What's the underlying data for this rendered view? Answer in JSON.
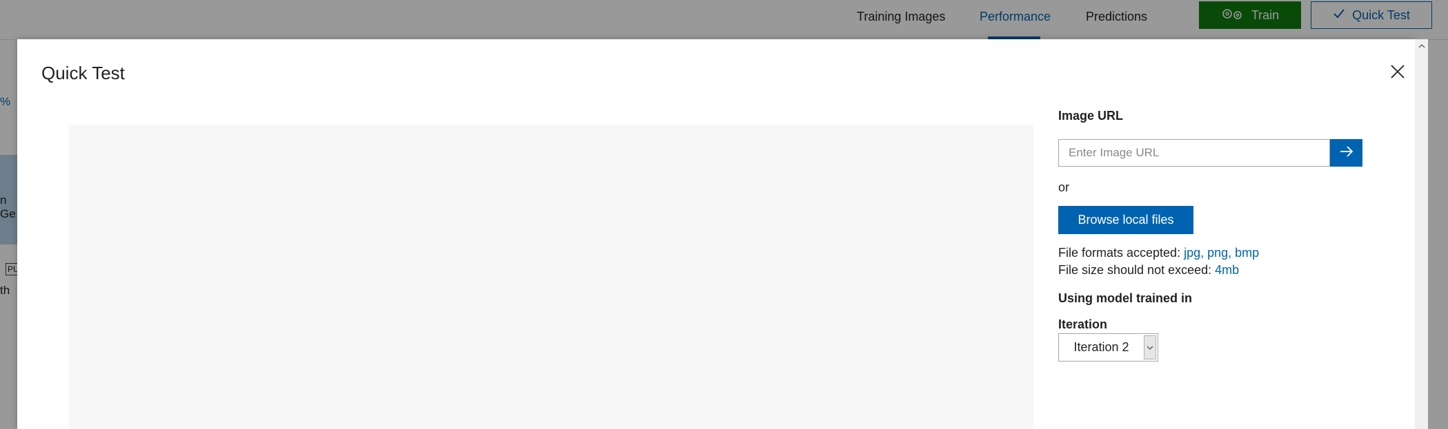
{
  "background": {
    "nav_tabs": [
      {
        "label": "Training Images",
        "active": false
      },
      {
        "label": "Performance",
        "active": true
      },
      {
        "label": "Predictions",
        "active": false
      }
    ],
    "train_label": "Train",
    "quick_test_label": "Quick Test",
    "fragments": [
      "%",
      "n Ge",
      "PU",
      "th"
    ],
    "colors": {
      "accent": "#0063b1",
      "train_green": "#107c10"
    }
  },
  "modal": {
    "title": "Quick Test",
    "close_icon": "close-icon",
    "image_url_label": "Image URL",
    "url_input_placeholder": "Enter Image URL",
    "url_input_value": "",
    "url_submit_icon": "arrow-right-icon",
    "or_text": "or",
    "browse_label": "Browse local files",
    "file_formats_prefix": "File formats accepted:",
    "file_formats_value": "jpg, png, bmp",
    "file_size_prefix": "File size should not exceed:",
    "file_size_value": "4mb",
    "model_label": "Using model trained in",
    "iteration_label": "Iteration",
    "iteration_value": "Iteration 2"
  }
}
